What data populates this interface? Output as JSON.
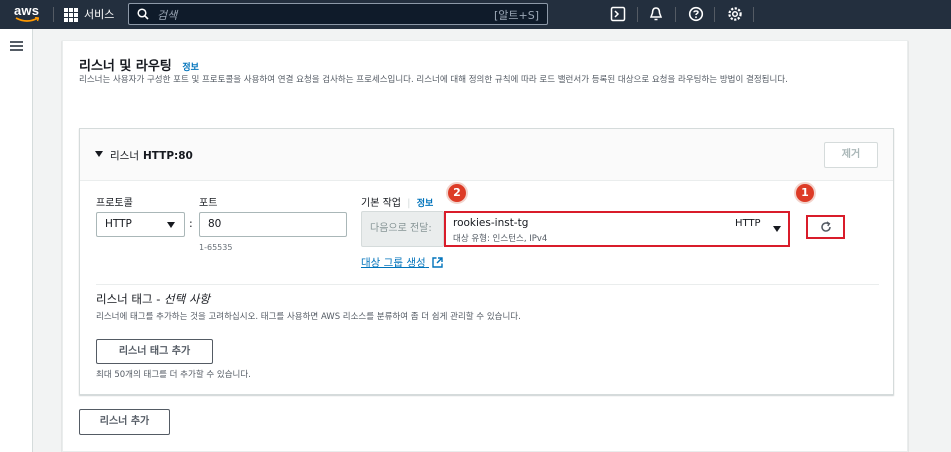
{
  "topnav": {
    "logo_text": "aws",
    "services_label": "서비스",
    "search_placeholder": "검색",
    "search_shortcut": "[알트+S]",
    "icons": [
      "terminal-icon",
      "bell-icon",
      "help-icon",
      "settings-icon"
    ]
  },
  "section": {
    "title": "리스너 및 라우팅",
    "info_link": "정보",
    "description": "리스너는 사용자가 구성한 포트 및 프로토콜을 사용하여 연결 요청을 검사하는 프로세스입니다. 리스너에 대해 정의한 규칙에 따라 로드 밸런서가 등록된 대상으로 요청을 라우팅하는 방법이 결정됩니다."
  },
  "listener": {
    "header_prefix": "리스너",
    "header_name": "HTTP:80",
    "remove_label": "제거",
    "protocol_label": "프로토콜",
    "protocol_value": "HTTP",
    "port_label": "포트",
    "port_value": "80",
    "port_hint": "1-65535",
    "default_action_label": "기본 작업",
    "default_action_info": "정보",
    "forward_label": "다음으로 전달:",
    "target_group": {
      "name": "rookies-inst-tg",
      "type": "대상 유형: 인스턴스, IPv4",
      "protocol": "HTTP"
    },
    "create_target_group_link": "대상 그룹 생성",
    "annotations": [
      "1",
      "2"
    ],
    "tags": {
      "title": "리스너 태그 - ",
      "title_optional": "선택 사항",
      "description": "리스너에 태그를 추가하는 것을 고려하십시오. 태그를 사용하면 AWS 리소스를 분류하여 좀 더 쉽게 관리할 수 있습니다.",
      "add_button": "리스너 태그 추가",
      "limit_text": "최대 50개의 태그를 더 추가할 수 있습니다."
    }
  },
  "add_listener_label": "리스너 추가",
  "colors": {
    "nav_bg": "#232f3e",
    "highlight_red": "#d91c2a",
    "link_blue": "#0073bb"
  }
}
